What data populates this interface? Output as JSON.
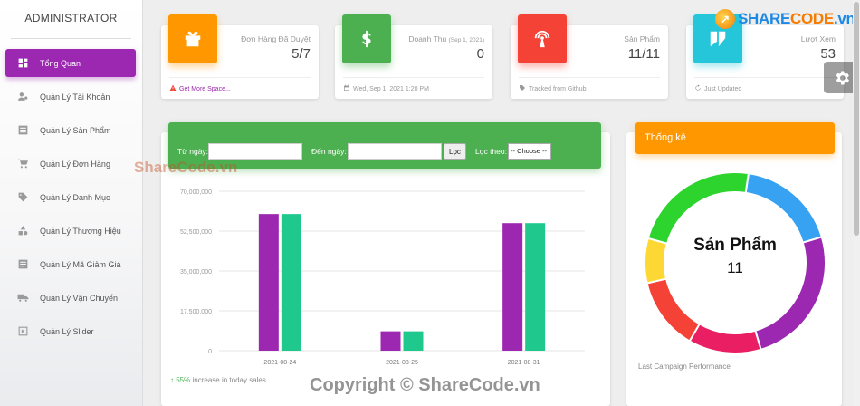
{
  "sidebar": {
    "title": "ADMINISTRATOR",
    "items": [
      {
        "label": "Tổng Quan",
        "icon": "dashboard-icon",
        "active": true
      },
      {
        "label": "Quản Lý Tài Khoản",
        "icon": "users-icon"
      },
      {
        "label": "Quản Lý Sản Phẩm",
        "icon": "list-icon"
      },
      {
        "label": "Quản Lý Đơn Hàng",
        "icon": "cart-icon"
      },
      {
        "label": "Quản Lý Danh Mục",
        "icon": "tag-icon"
      },
      {
        "label": "Quản Lý Thương Hiệu",
        "icon": "shapes-icon"
      },
      {
        "label": "Quản Lý Mã Giảm Giá",
        "icon": "ticket-icon"
      },
      {
        "label": "Quản Lý Vận Chuyển",
        "icon": "truck-icon"
      },
      {
        "label": "Quản Lý Slider",
        "icon": "slider-icon"
      }
    ]
  },
  "stats": [
    {
      "title": "Đơn Hàng Đã Duyệt",
      "value": "5/7",
      "footer": "Get More Space...",
      "color": "#ff9800",
      "icon": "gift-icon",
      "footer_icon": "warning-icon"
    },
    {
      "title": "Doanh Thu",
      "subtitle": "(Sep 1, 2021)",
      "value": "0",
      "footer": "Wed, Sep 1, 2021 1:20 PM",
      "color": "#4caf50",
      "icon": "dollar-icon",
      "footer_icon": "calendar-icon"
    },
    {
      "title": "Sản Phẩm",
      "value": "11/11",
      "footer": "Tracked from Github",
      "color": "#f44336",
      "icon": "broadcast-icon",
      "footer_icon": "tag-icon"
    },
    {
      "title": "Lượt Xem",
      "value": "53",
      "footer": "Just Updated",
      "color": "#26c6da",
      "icon": "view-icon",
      "footer_icon": "refresh-icon"
    }
  ],
  "filter": {
    "from_label": "Từ ngày:",
    "to_label": "Đến ngày:",
    "button": "Lọc",
    "by_label": "Lọc theo:",
    "select_value": "-- Choose --"
  },
  "chart_data": {
    "type": "bar",
    "categories": [
      "2021-08-24",
      "2021-08-25",
      "2021-08-31"
    ],
    "series": [
      {
        "values": [
          60000000,
          8500000,
          56000000
        ],
        "color": "#9c27b0"
      },
      {
        "values": [
          60000000,
          8500000,
          56000000
        ],
        "color": "#1fc98e"
      }
    ],
    "yticks": [
      "70,000,000",
      "52,500,000",
      "35,000,000",
      "17,500,000",
      "0"
    ],
    "ylim": [
      0,
      70000000
    ],
    "grid": true
  },
  "chart_footer": {
    "percent": "55%",
    "text": "increase in today sales."
  },
  "donut": {
    "header": "Thống kê",
    "label": "Sản Phẩm",
    "value": "11",
    "footer": "Last Campaign Performance",
    "segments": [
      {
        "value": 18,
        "color": "#37a2f2"
      },
      {
        "value": 25,
        "color": "#9c27b0"
      },
      {
        "value": 13,
        "color": "#e91e63"
      },
      {
        "value": 13,
        "color": "#f44336"
      },
      {
        "value": 8,
        "color": "#fdd835"
      },
      {
        "value": 23,
        "color": "#2ed42e"
      }
    ]
  },
  "watermark": {
    "brand_a": "SHARE",
    "brand_b": "CODE",
    "brand_c": ".vn",
    "mid": "ShareCode.vn",
    "copyright": "Copyright © ShareCode.vn"
  }
}
